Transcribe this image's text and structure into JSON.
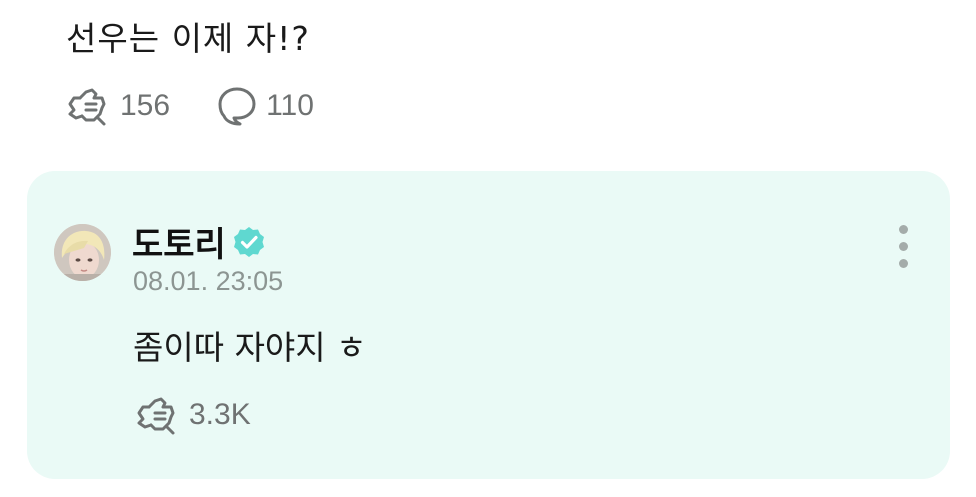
{
  "post": {
    "text": "선우는 이제 자!?",
    "likes_count": "156",
    "comments_count": "110"
  },
  "reply": {
    "author_name": "도토리",
    "timestamp": "08.01. 23:05",
    "text": "좀이따 자야지 ㅎ",
    "likes_count": "3.3K"
  },
  "colors": {
    "card_background": "#eafaf6",
    "verified_badge": "#5fd8d0",
    "muted_text": "#8c9592",
    "icon": "#6f7272"
  },
  "icons": {
    "like": "like-hand-icon",
    "comment": "speech-bubble-icon",
    "verified": "verified-badge-icon",
    "more": "more-vertical-icon"
  }
}
